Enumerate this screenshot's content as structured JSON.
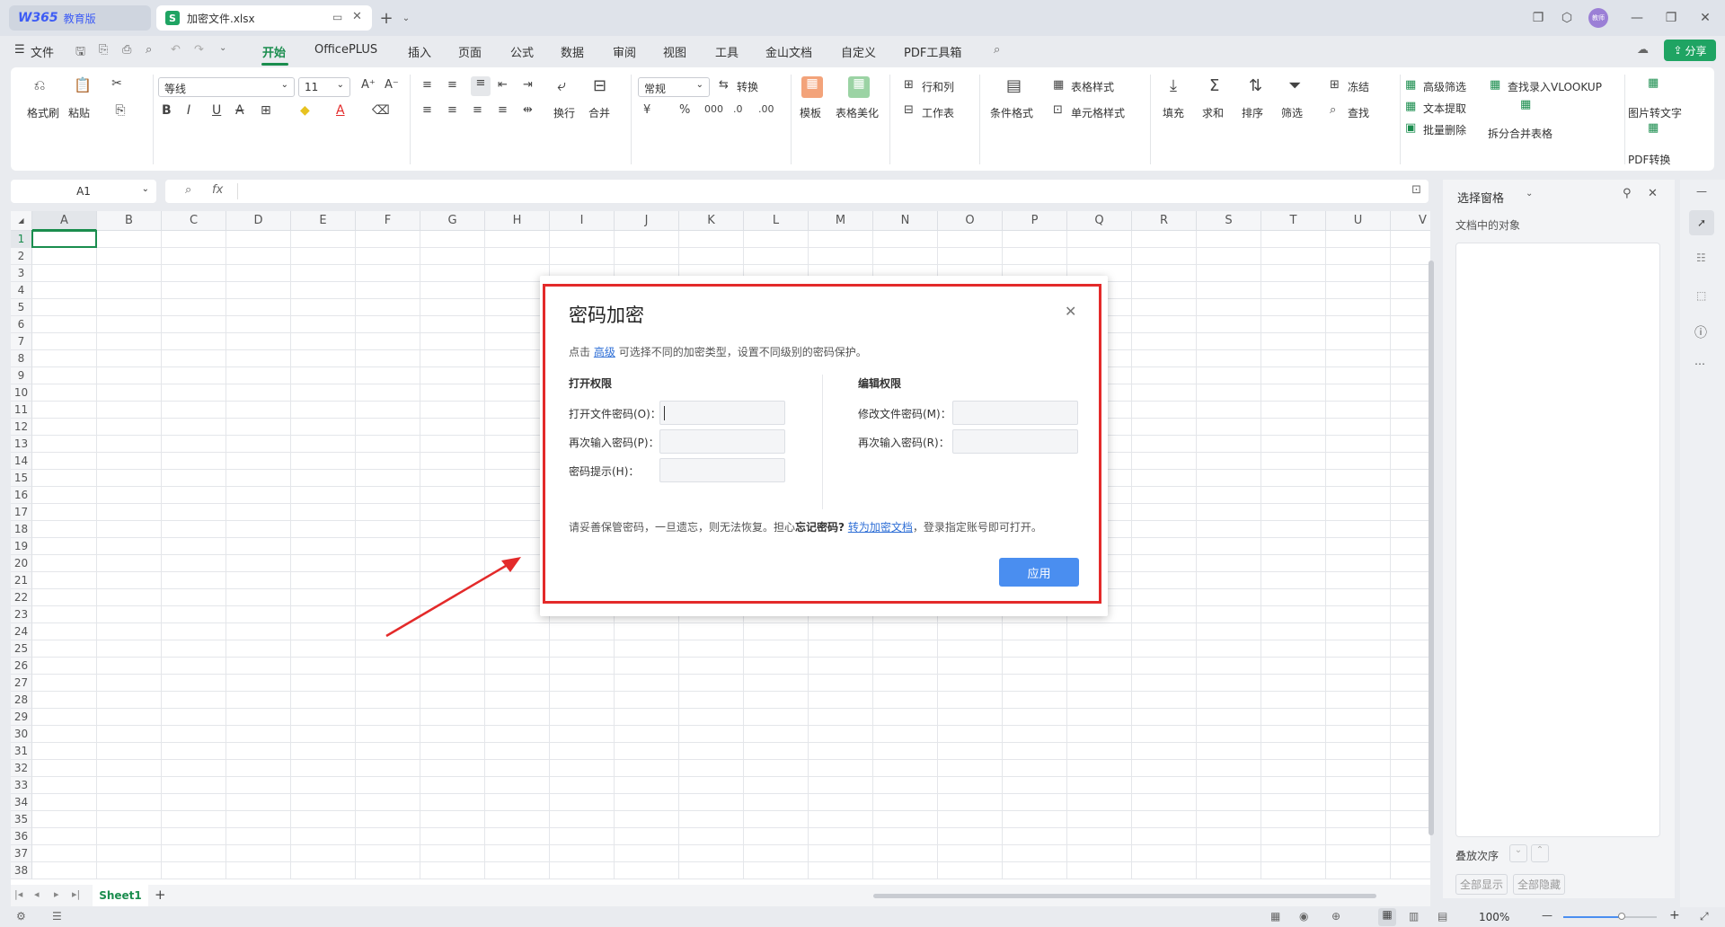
{
  "titlebar": {
    "wps_tab_logo": "W365",
    "wps_tab_label": "教育版",
    "file_tab_icon": "S",
    "file_tab_label": "加密文件.xlsx",
    "add_tab": "+",
    "avatar_text": "教师"
  },
  "menubar": {
    "file_label": "文件",
    "items": [
      "开始",
      "OfficePLUS",
      "插入",
      "页面",
      "公式",
      "数据",
      "审阅",
      "视图",
      "工具",
      "金山文档",
      "自定义",
      "PDF工具箱"
    ],
    "share_label": "分享"
  },
  "ribbon": {
    "format_painter": "格式刷",
    "paste": "粘贴",
    "font_name": "等线",
    "font_size": "11",
    "wrap": "换行",
    "merge": "合并",
    "number_format": "常规",
    "convert": "转换",
    "template": "模板",
    "table_beautify": "表格美化",
    "row_col": "行和列",
    "worksheet": "工作表",
    "conditional_format": "条件格式",
    "table_style": "表格样式",
    "cell_style": "单元格样式",
    "fill": "填充",
    "sum": "求和",
    "sort": "排序",
    "filter": "筛选",
    "freeze": "冻结",
    "find": "查找",
    "advanced_filter": "高级筛选",
    "text_extract": "文本提取",
    "batch_delete": "批量删除",
    "vlookup": "查找录入VLOOKUP",
    "split_merge": "拆分合并表格",
    "pic_to_text": "图片转文字",
    "pdf_convert": "PDF转换"
  },
  "formula": {
    "name_box": "A1",
    "fx": "fx"
  },
  "grid": {
    "columns": [
      "A",
      "B",
      "C",
      "D",
      "E",
      "F",
      "G",
      "H",
      "I",
      "J",
      "K",
      "L",
      "M",
      "N",
      "O",
      "P",
      "Q",
      "R",
      "S",
      "T",
      "U",
      "V"
    ],
    "rows": [
      "1",
      "2",
      "3",
      "4",
      "5",
      "6",
      "7",
      "8",
      "9",
      "10",
      "11",
      "12",
      "13",
      "14",
      "15",
      "16",
      "17",
      "18",
      "19",
      "20",
      "21",
      "22",
      "23",
      "24",
      "25",
      "26",
      "27",
      "28",
      "29",
      "30",
      "31",
      "32",
      "33",
      "34",
      "35",
      "36",
      "37",
      "38"
    ]
  },
  "sheets": {
    "active": "Sheet1",
    "add": "+"
  },
  "rightpane": {
    "title": "选择窗格",
    "subtitle": "文档中的对象",
    "order_label": "叠放次序",
    "show_all": "全部显示",
    "hide_all": "全部隐藏"
  },
  "statusbar": {
    "zoom": "100%"
  },
  "dialog": {
    "title": "密码加密",
    "desc_prefix": "点击",
    "desc_link": "高级",
    "desc_suffix": "可选择不同的加密类型，设置不同级别的密码保护。",
    "open_section": "打开权限",
    "edit_section": "编辑权限",
    "open_password_label": "打开文件密码(O)：",
    "open_reenter_label": "再次输入密码(P)：",
    "hint_label": "密码提示(H)：",
    "edit_password_label": "修改文件密码(M)：",
    "edit_reenter_label": "再次输入密码(R)：",
    "warning_prefix": "请妥善保管密码，一旦遗忘，则无法恢复。担心",
    "warning_bold": "忘记密码?",
    "warning_link": "转为加密文档",
    "warning_suffix": "，登录指定账号即可打开。",
    "apply_label": "应用"
  },
  "colors": {
    "accent_green": "#1a8d4e",
    "highlight_red": "#e32a2a",
    "apply_blue": "#4a8ef0"
  }
}
